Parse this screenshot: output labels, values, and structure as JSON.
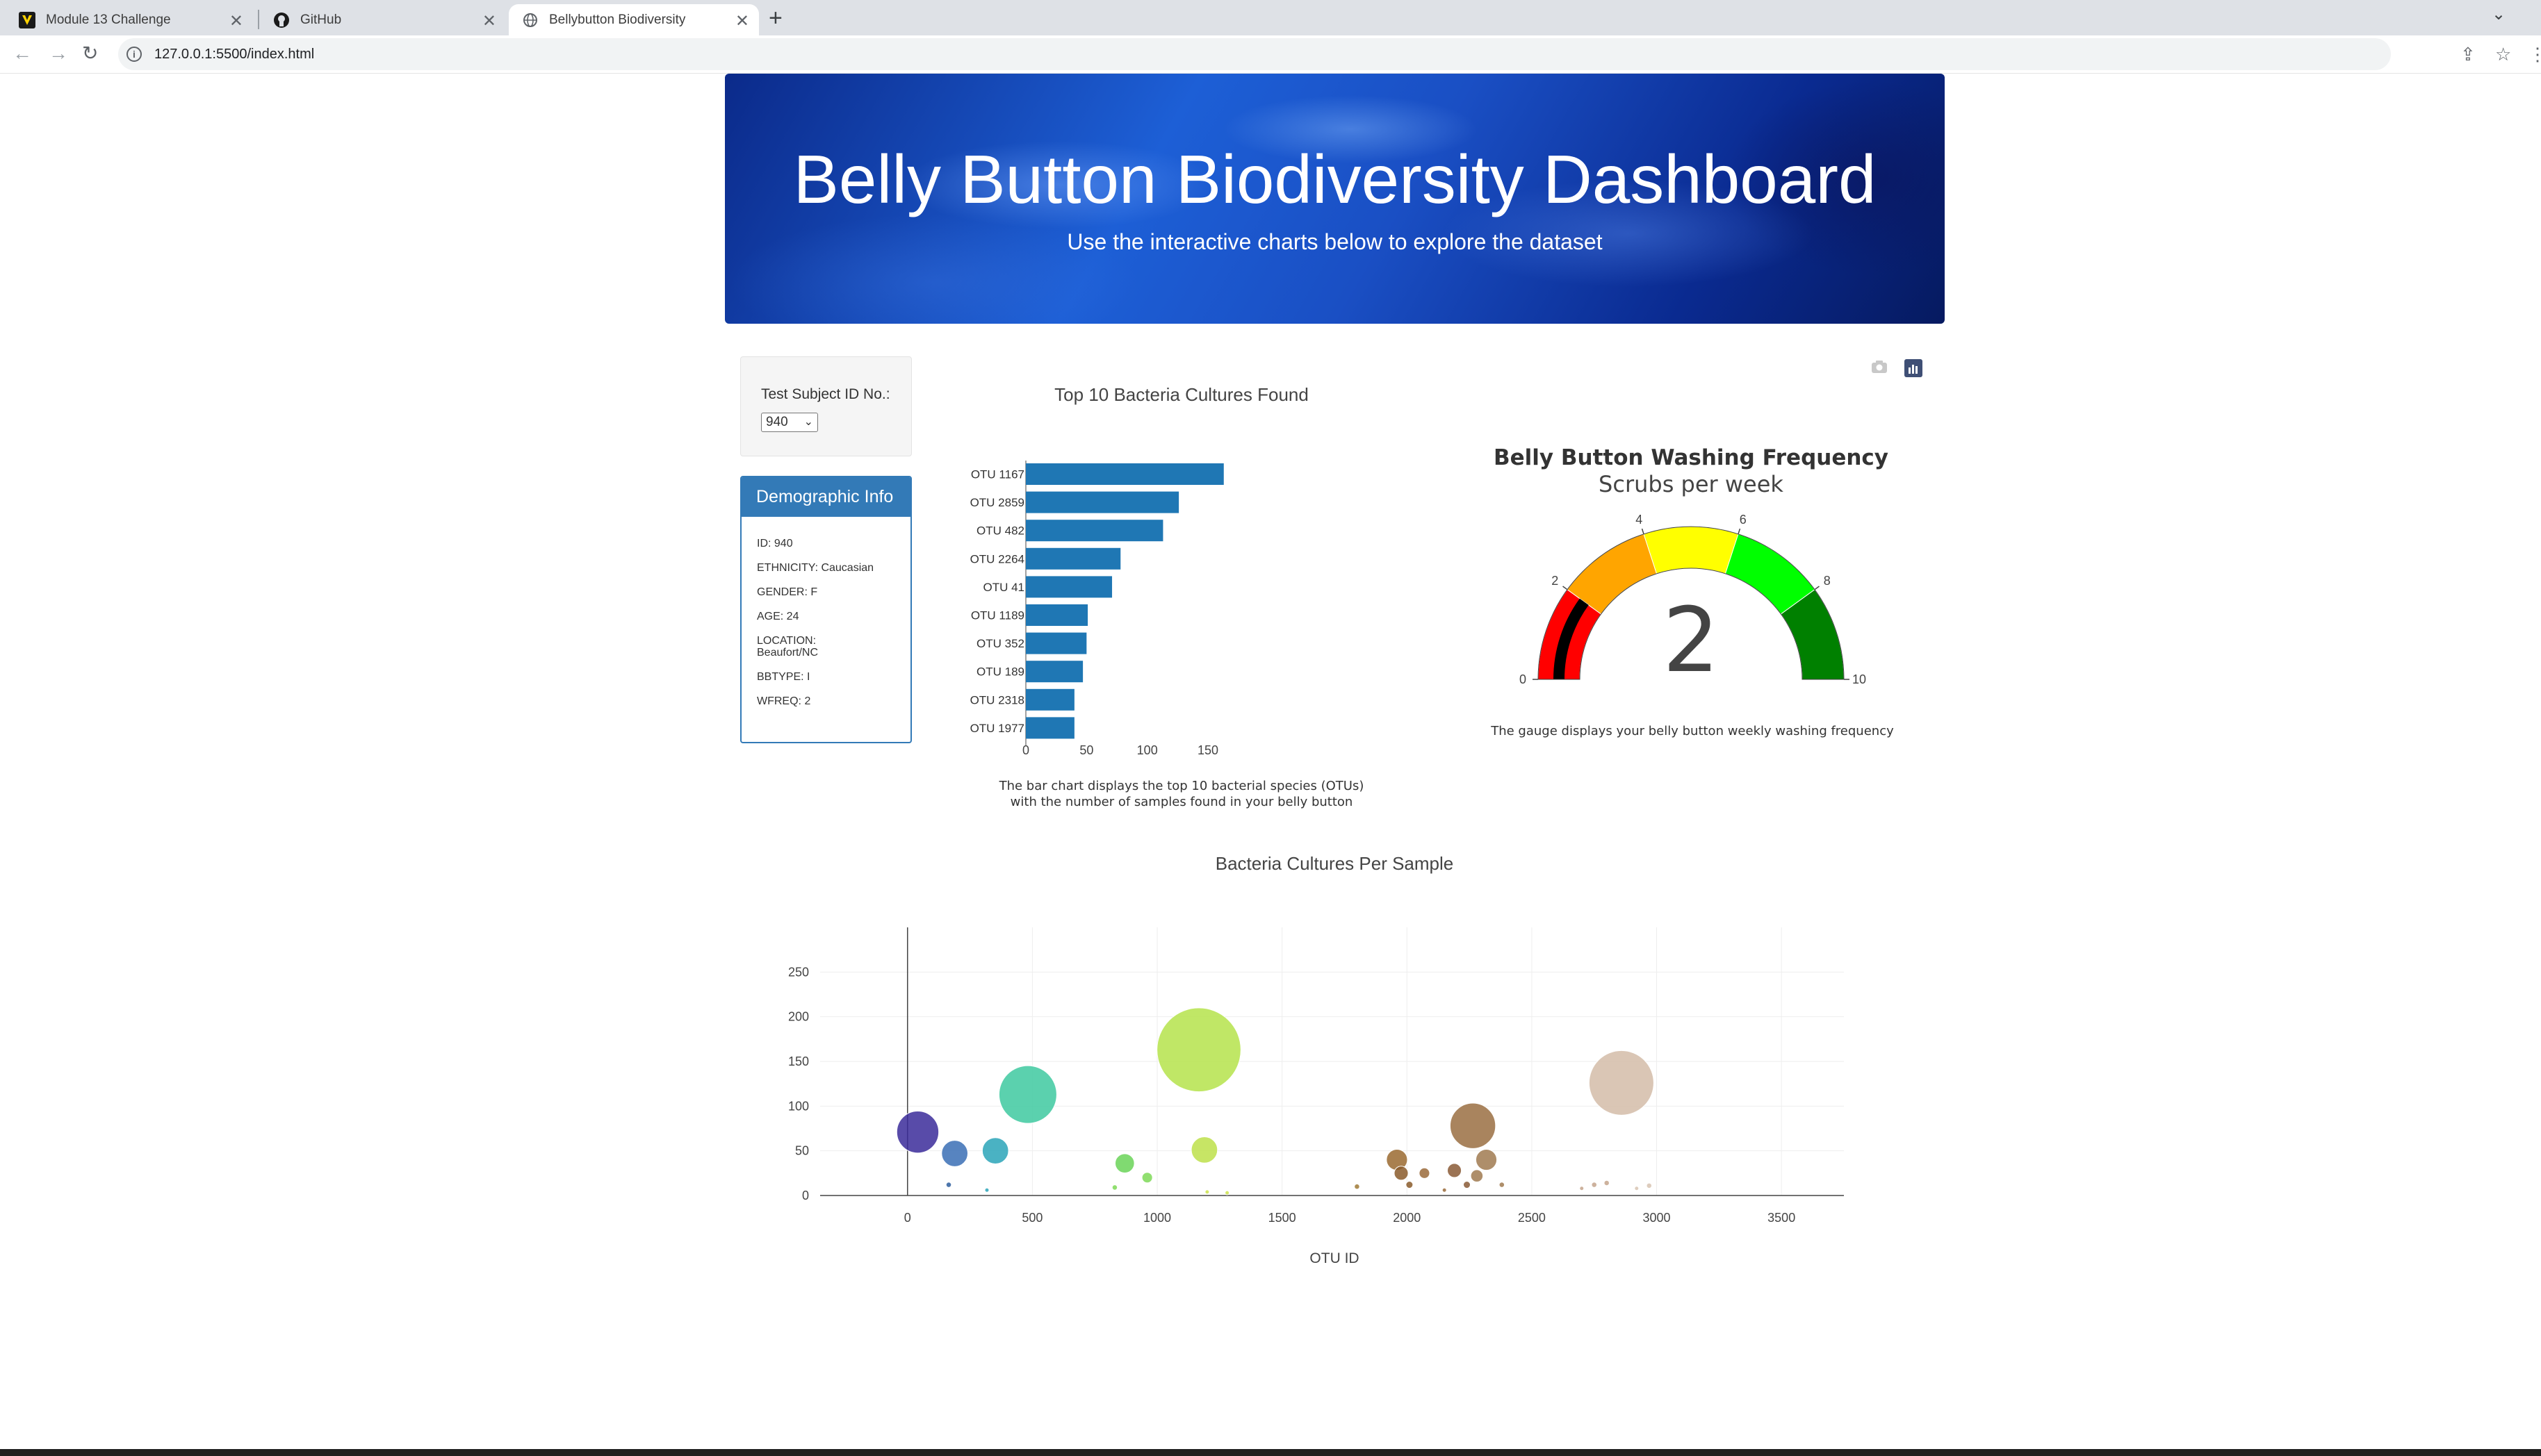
{
  "browser": {
    "tabs": [
      {
        "title": "Module 13 Challenge",
        "icon": "v-logo-icon"
      },
      {
        "title": "GitHub",
        "icon": "github-icon"
      },
      {
        "title": "Bellybutton Biodiversity",
        "icon": "globe-icon"
      }
    ],
    "url": "127.0.0.1:5500/index.html"
  },
  "header": {
    "title": "Belly Button Biodiversity Dashboard",
    "subtitle": "Use the interactive charts below to explore the dataset"
  },
  "selector": {
    "label": "Test Subject ID No.:",
    "value": "940"
  },
  "demographic": {
    "heading": "Demographic Info",
    "rows": [
      "ID: 940",
      "ETHNICITY: Caucasian",
      "GENDER: F",
      "AGE: 24",
      "LOCATION: Beaufort/NC",
      "BBTYPE: I",
      "WFREQ: 2"
    ]
  },
  "chart_data": [
    {
      "type": "bar",
      "orientation": "horizontal",
      "title": "Top 10 Bacteria Cultures Found",
      "categories": [
        "OTU 1167",
        "OTU 2859",
        "OTU 482",
        "OTU 2264",
        "OTU 41",
        "OTU 1189",
        "OTU 352",
        "OTU 189",
        "OTU 2318",
        "OTU 1977"
      ],
      "values": [
        163,
        126,
        113,
        78,
        71,
        51,
        50,
        47,
        40,
        40
      ],
      "xticks": [
        "0",
        "50",
        "100",
        "150"
      ],
      "xlim": [
        0,
        170
      ],
      "color": "#1f77b4",
      "caption": [
        "The bar chart displays the top 10 bacterial species (OTUs)",
        "with the number of samples found in your belly button"
      ]
    },
    {
      "type": "gauge",
      "title": "Belly Button Washing Frequency",
      "subtitle": "Scrubs per week",
      "value": 2,
      "range": [
        0,
        10
      ],
      "ticks": [
        "0",
        "2",
        "4",
        "6",
        "8",
        "10"
      ],
      "bands": [
        {
          "from": 0,
          "to": 2,
          "color": "#ff0000"
        },
        {
          "from": 2,
          "to": 4,
          "color": "#ffa500"
        },
        {
          "from": 4,
          "to": 6,
          "color": "#ffff00"
        },
        {
          "from": 6,
          "to": 8,
          "color": "#00ff00"
        },
        {
          "from": 8,
          "to": 10,
          "color": "#008000"
        }
      ],
      "bar_color": "#000000",
      "caption": "The gauge displays your belly button weekly washing frequency"
    },
    {
      "type": "scatter",
      "title": "Bacteria Cultures Per Sample",
      "xlabel": "OTU ID",
      "xticks": [
        "0",
        "500",
        "1000",
        "1500",
        "2000",
        "2500",
        "3000",
        "3500"
      ],
      "yticks": [
        "0",
        "50",
        "100",
        "150",
        "200",
        "250"
      ],
      "xlim": [
        -350,
        3750
      ],
      "ylim": [
        0,
        300
      ],
      "grid": true,
      "points": [
        {
          "x": 41,
          "y": 71,
          "r": 24,
          "color": "#3b2b9a"
        },
        {
          "x": 189,
          "y": 47,
          "r": 15,
          "color": "#3a6fb5"
        },
        {
          "x": 165,
          "y": 12,
          "r": 3,
          "color": "#2e5e9e"
        },
        {
          "x": 352,
          "y": 50,
          "r": 15,
          "color": "#2aa5b8"
        },
        {
          "x": 318,
          "y": 6,
          "r": 2,
          "color": "#2aa5b8"
        },
        {
          "x": 482,
          "y": 113,
          "r": 33,
          "color": "#3ec9a0"
        },
        {
          "x": 870,
          "y": 36,
          "r": 11,
          "color": "#6ad358"
        },
        {
          "x": 960,
          "y": 20,
          "r": 6,
          "color": "#7ed957"
        },
        {
          "x": 830,
          "y": 9,
          "r": 3,
          "color": "#7ed957"
        },
        {
          "x": 1167,
          "y": 163,
          "r": 48,
          "color": "#b5e34b"
        },
        {
          "x": 1189,
          "y": 51,
          "r": 15,
          "color": "#bde14a"
        },
        {
          "x": 1200,
          "y": 4,
          "r": 2,
          "color": "#cde34b"
        },
        {
          "x": 1280,
          "y": 3,
          "r": 1,
          "color": "#cde34b"
        },
        {
          "x": 1800,
          "y": 10,
          "r": 3,
          "color": "#a07a36"
        },
        {
          "x": 1960,
          "y": 40,
          "r": 12,
          "color": "#9a6a30"
        },
        {
          "x": 1977,
          "y": 25,
          "r": 8,
          "color": "#8a5a2a"
        },
        {
          "x": 2010,
          "y": 12,
          "r": 4,
          "color": "#8a5a2a"
        },
        {
          "x": 2070,
          "y": 25,
          "r": 6,
          "color": "#9a6a3a"
        },
        {
          "x": 2150,
          "y": 6,
          "r": 2,
          "color": "#9a6a3a"
        },
        {
          "x": 2190,
          "y": 28,
          "r": 8,
          "color": "#8a5a36"
        },
        {
          "x": 2240,
          "y": 12,
          "r": 4,
          "color": "#8a5a36"
        },
        {
          "x": 2264,
          "y": 78,
          "r": 26,
          "color": "#9a6e42"
        },
        {
          "x": 2318,
          "y": 40,
          "r": 12,
          "color": "#a07a50"
        },
        {
          "x": 2280,
          "y": 22,
          "r": 7,
          "color": "#a07a50"
        },
        {
          "x": 2380,
          "y": 12,
          "r": 3,
          "color": "#a07a50"
        },
        {
          "x": 2700,
          "y": 8,
          "r": 2,
          "color": "#c4a48c"
        },
        {
          "x": 2750,
          "y": 12,
          "r": 3,
          "color": "#c4a48c"
        },
        {
          "x": 2800,
          "y": 14,
          "r": 3,
          "color": "#c4a48c"
        },
        {
          "x": 2859,
          "y": 126,
          "r": 37,
          "color": "#d4bca8"
        },
        {
          "x": 2920,
          "y": 8,
          "r": 2,
          "color": "#d8c4b2"
        },
        {
          "x": 2970,
          "y": 11,
          "r": 3,
          "color": "#d8c4b2"
        }
      ]
    }
  ]
}
